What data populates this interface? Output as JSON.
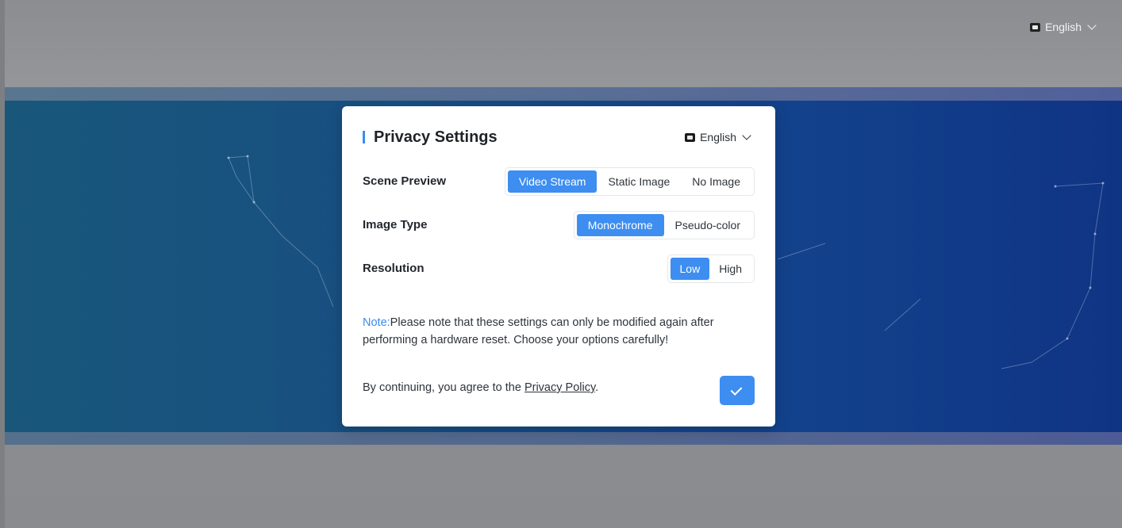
{
  "top_language": {
    "label": "English"
  },
  "modal": {
    "title": "Privacy Settings",
    "language": {
      "label": "English"
    },
    "rows": [
      {
        "label": "Scene Preview",
        "options": [
          "Video Stream",
          "Static Image",
          "No Image"
        ],
        "selected": "Video Stream"
      },
      {
        "label": "Image Type",
        "options": [
          "Monochrome",
          "Pseudo-color"
        ],
        "selected": "Monochrome"
      },
      {
        "label": "Resolution",
        "options": [
          "Low",
          "High"
        ],
        "selected": "Low"
      }
    ],
    "note": {
      "label": "Note:",
      "text": "Please note that these settings can only be modified again after performing a hardware reset. Choose your options carefully!"
    },
    "footer": {
      "prefix": "By continuing, you agree to the ",
      "link": "Privacy Policy",
      "suffix": "."
    }
  },
  "colors": {
    "accent": "#3d8ef0",
    "overlay": "#8e9094",
    "band": "#174f82"
  },
  "icons": {
    "language": "language-icon",
    "dropdown": "chevron-down-icon",
    "confirm": "check-icon"
  }
}
